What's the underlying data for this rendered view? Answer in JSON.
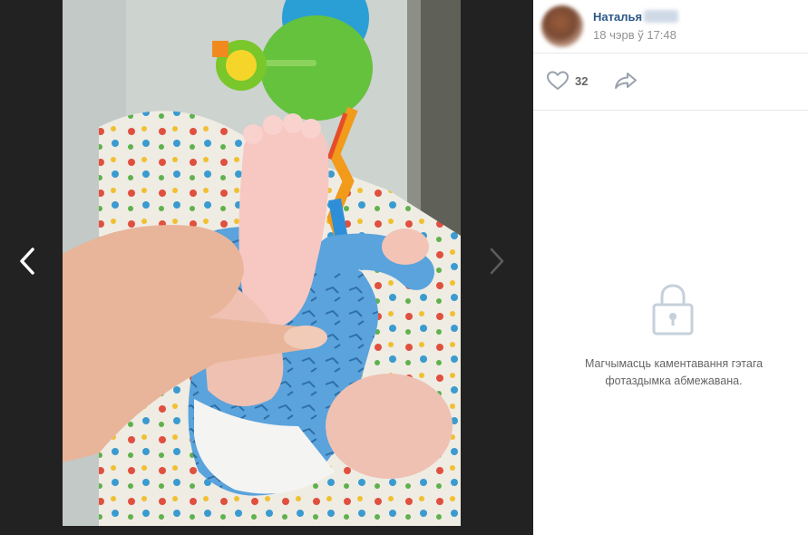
{
  "post": {
    "author_name": "Наталья",
    "date": "18 чэрв ў 17:48",
    "likes": "32"
  },
  "comments": {
    "restricted_line1": "Магчымасць каментавання гэтага",
    "restricted_line2": "фотаздымка абмежавана."
  },
  "icons": {
    "prev": "chevron-left-icon",
    "next": "chevron-right-icon",
    "like": "heart-icon",
    "share": "share-arrow-icon",
    "lock": "lock-icon"
  },
  "colors": {
    "viewer_bg": "#222222",
    "link": "#2a5885",
    "muted": "#939393",
    "icon": "#99a2ad"
  }
}
